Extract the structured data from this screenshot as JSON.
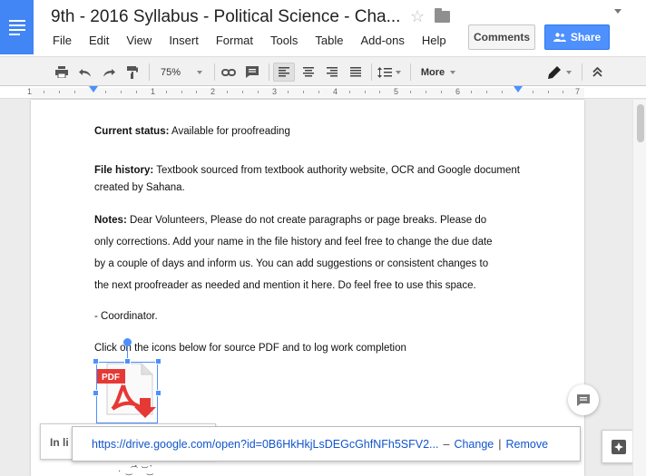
{
  "app": {
    "title": "9th - 2016 Syllabus - Political Science - Cha...",
    "comments_label": "Comments",
    "share_label": "Share"
  },
  "menu": [
    "File",
    "Edit",
    "View",
    "Insert",
    "Format",
    "Tools",
    "Table",
    "Add-ons",
    "Help",
    "..."
  ],
  "toolbar": {
    "zoom": "75%",
    "more_label": "More",
    "icons": [
      "print-icon",
      "undo-icon",
      "redo-icon",
      "paint-format-icon",
      "link-icon",
      "comment-icon",
      "align-left-icon",
      "align-center-icon",
      "align-right-icon",
      "justify-icon",
      "line-spacing-icon",
      "pen-icon",
      "collapse-icon"
    ]
  },
  "ruler": {
    "numbers": [
      "1",
      "1",
      "2",
      "3",
      "4",
      "5",
      "6",
      "7"
    ]
  },
  "document": {
    "status_label": "Current status:",
    "status_value": "Available for proofreading",
    "history_label": "File history:",
    "history_line1": "Textbook sourced from textbook authority website, OCR and Google document",
    "history_line2": "created by Sahana.",
    "notes_label": "Notes:",
    "notes_line1": "Dear Volunteers, Please do not create paragraphs or page breaks. Please do",
    "notes_line2": "only corrections. Add your name in the file history and feel free to change the due date",
    "notes_line3": "by a couple of days and inform us. You can add suggestions or consistent changes to",
    "notes_line4": "the next proofreader as needed and mention it here. Do feel free to use this space.",
    "signature": "- Coordinator.",
    "instruction": "Click on the icons below for source PDF and to log work completion",
    "pdf_badge": "PDF"
  },
  "inline_bubble": {
    "label": "In li"
  },
  "link_bubble": {
    "url": "https://drive.google.com/open?id=0B6HkHkjLsDEGcGhfNFh5SFV2...",
    "dash": "–",
    "change_label": "Change",
    "divider": "|",
    "remove_label": "Remove"
  },
  "colors": {
    "brand_blue": "#4285f4",
    "share_blue": "#4d90fe",
    "link_blue": "#1155cc",
    "pdf_red": "#e53935"
  }
}
